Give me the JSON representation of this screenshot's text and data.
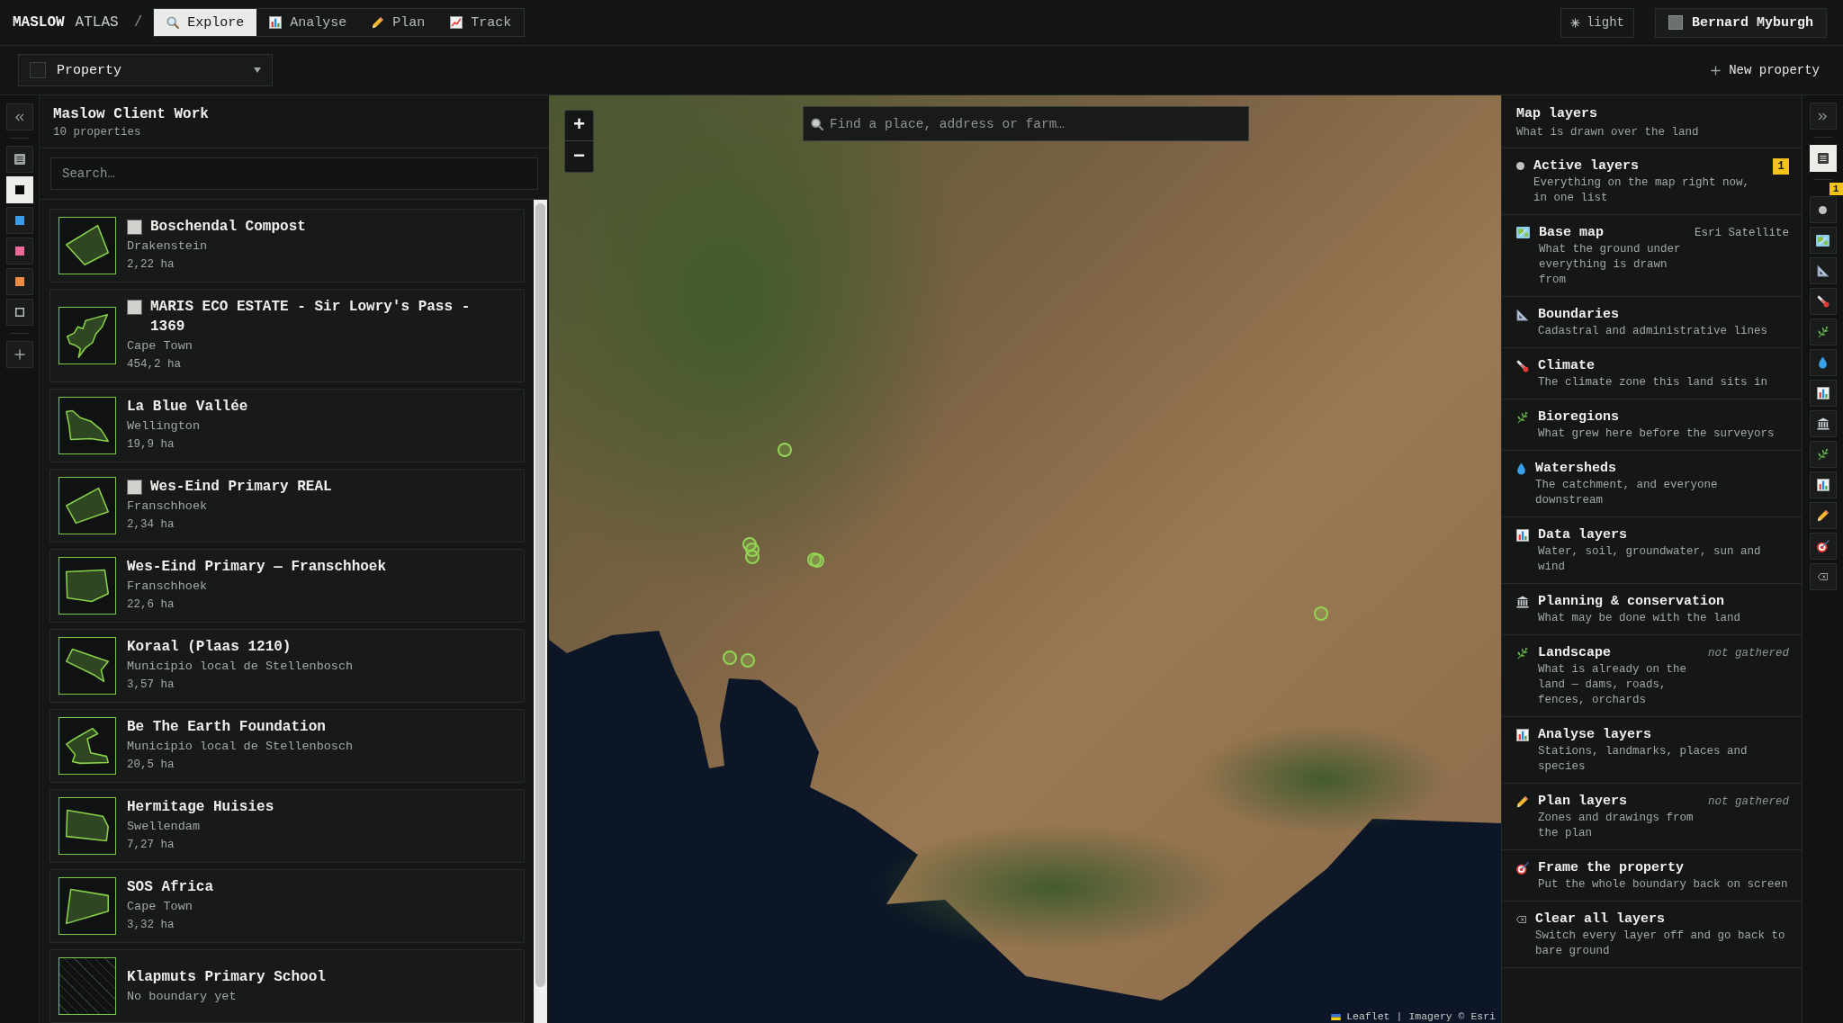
{
  "topbar": {
    "brand": "MASLOW",
    "brand_sub": "ATLAS",
    "separator": "/",
    "tabs": [
      {
        "label": "Explore",
        "selected": true
      },
      {
        "label": "Analyse",
        "selected": false
      },
      {
        "label": "Plan",
        "selected": false
      },
      {
        "label": "Track",
        "selected": false
      }
    ],
    "theme_toggle": "light",
    "user": {
      "name": "Bernard Myburgh"
    }
  },
  "toolbar": {
    "property_select": {
      "value": "Property"
    },
    "new_property": "New property"
  },
  "left_rail": {
    "items": [
      {
        "kind": "list",
        "selected": false
      },
      {
        "kind": "swatch",
        "color": "#0b0b0b",
        "selected": true
      },
      {
        "kind": "swatch",
        "color": "#3d9be9",
        "selected": false
      },
      {
        "kind": "swatch",
        "color": "#ee6a9a",
        "selected": false
      },
      {
        "kind": "swatch",
        "color": "#ef8a45",
        "selected": false
      },
      {
        "kind": "outline",
        "selected": false
      }
    ]
  },
  "property_panel": {
    "title": "Maslow Client Work",
    "count": "10 properties",
    "search": {
      "placeholder": "Search…"
    },
    "properties": [
      {
        "name": "Boschendal Compost",
        "logo": true,
        "place": "Drakenstein",
        "area": "2,22 ha",
        "has_boundary": true
      },
      {
        "name": "MARIS ECO ESTATE - Sir Lowry's Pass - 1369",
        "logo": true,
        "place": "Cape Town",
        "area": "454,2 ha",
        "has_boundary": true
      },
      {
        "name": "La Blue Vallée",
        "logo": false,
        "place": "Wellington",
        "area": "19,9 ha",
        "has_boundary": true
      },
      {
        "name": "Wes-Eind Primary REAL",
        "logo": true,
        "place": "Franschhoek",
        "area": "2,34 ha",
        "has_boundary": true
      },
      {
        "name": "Wes-Eind Primary — Franschhoek",
        "logo": false,
        "place": "Franschhoek",
        "area": "22,6 ha",
        "has_boundary": true
      },
      {
        "name": "Koraal (Plaas 1210)",
        "logo": false,
        "place": "Municipio local de Stellenbosch",
        "area": "3,57 ha",
        "has_boundary": true
      },
      {
        "name": "Be The Earth Foundation",
        "logo": false,
        "place": "Municipio local de Stellenbosch",
        "area": "20,5 ha",
        "has_boundary": true
      },
      {
        "name": "Hermitage Huisies",
        "logo": false,
        "place": "Swellendam",
        "area": "7,27 ha",
        "has_boundary": true
      },
      {
        "name": "SOS Africa",
        "logo": false,
        "place": "Cape Town",
        "area": "3,32 ha",
        "has_boundary": true
      },
      {
        "name": "Klapmuts Primary School",
        "logo": false,
        "status": "No boundary yet",
        "has_boundary": false
      }
    ]
  },
  "map": {
    "zoom_in": "+",
    "zoom_out": "−",
    "search": {
      "placeholder": "Find a place, address or farm…"
    },
    "attribution": {
      "link": "Leaflet",
      "separator": "|",
      "credit": "Imagery © Esri"
    }
  },
  "layers_panel": {
    "title": "Map layers",
    "subtitle": "What is drawn over the land",
    "items": [
      {
        "title": "Active layers",
        "description": "Everything on the map right now, in one list",
        "badge": "1"
      },
      {
        "title": "Base map",
        "description": "What the ground under everything is drawn from",
        "note": {
          "text": "Esri Satellite",
          "missing": false
        }
      },
      {
        "title": "Boundaries",
        "description": "Cadastral and administrative lines"
      },
      {
        "title": "Climate",
        "description": "The climate zone this land sits in"
      },
      {
        "title": "Bioregions",
        "description": "What grew here before the surveyors"
      },
      {
        "title": "Watersheds",
        "description": "The catchment, and everyone downstream"
      },
      {
        "title": "Data layers",
        "description": "Water, soil, groundwater, sun and wind"
      },
      {
        "title": "Planning & conservation",
        "description": "What may be done with the land"
      },
      {
        "title": "Landscape",
        "description": "What is already on the land — dams, roads, fences, orchards",
        "note": {
          "text": "not gathered",
          "missing": true
        }
      },
      {
        "title": "Analyse layers",
        "description": "Stations, landmarks, places and species"
      },
      {
        "title": "Plan layers",
        "description": "Zones and drawings from the plan",
        "note": {
          "text": "not gathered",
          "missing": true
        }
      },
      {
        "title": "Frame the property",
        "description": "Put the whole boundary back on screen"
      },
      {
        "title": "Clear all layers",
        "description": "Switch every layer off and go back to bare ground"
      }
    ]
  },
  "layer_rail": {
    "items": [
      {
        "selected": true
      },
      {
        "selected": false,
        "badge": "1"
      },
      {
        "selected": false
      },
      {
        "selected": false
      },
      {
        "selected": false
      },
      {
        "selected": false
      },
      {
        "selected": false
      },
      {
        "selected": false
      },
      {
        "selected": false
      },
      {
        "selected": false
      },
      {
        "selected": false
      },
      {
        "selected": false
      },
      {
        "selected": false
      },
      {
        "selected": false
      }
    ]
  }
}
